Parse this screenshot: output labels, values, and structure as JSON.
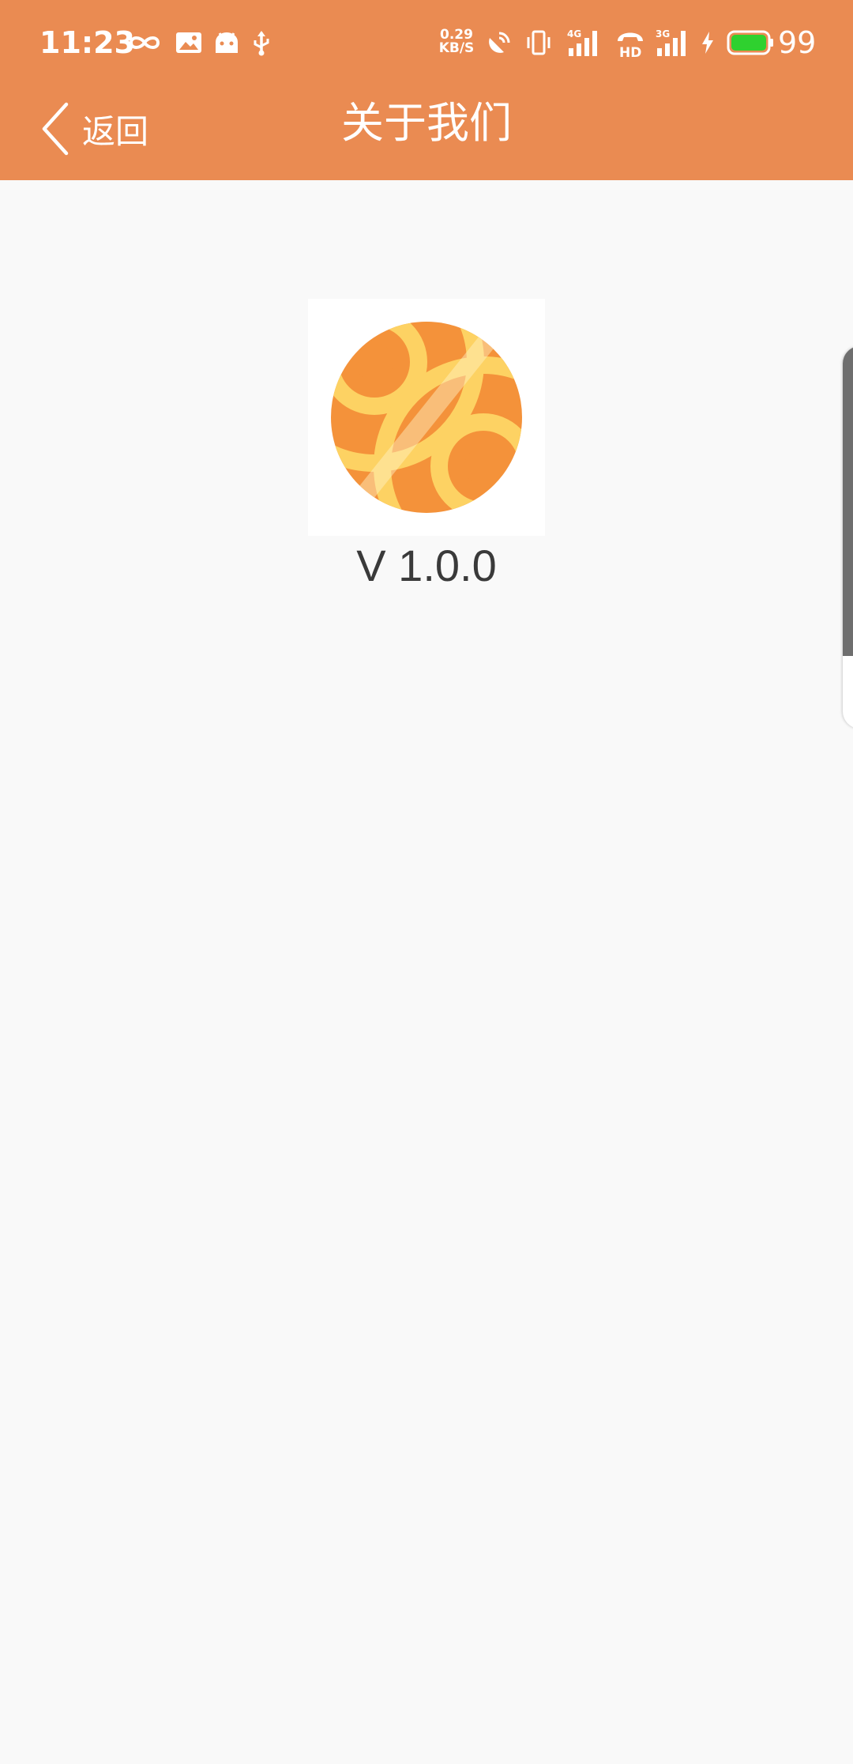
{
  "status_bar": {
    "time": "11:23",
    "net_speed_value": "0.29",
    "net_speed_unit": "KB/S",
    "battery_level": "99",
    "icons": [
      "infinity-icon",
      "image-icon",
      "android-icon",
      "usb-icon",
      "hotspot-icon",
      "vibrate-icon",
      "signal-4g-icon",
      "hd-call-icon",
      "signal-3g-icon",
      "charging-icon",
      "battery-icon"
    ],
    "signal_4g_label": "4G",
    "signal_3g_label": "3G",
    "hd_label": "HD",
    "battery_color": "#2fd12f"
  },
  "header": {
    "back_label": "返回",
    "title": "关于我们",
    "background_color": "#ea8b52"
  },
  "about": {
    "logo_icon": "app-logo-icon",
    "version": "V 1.0.0"
  }
}
